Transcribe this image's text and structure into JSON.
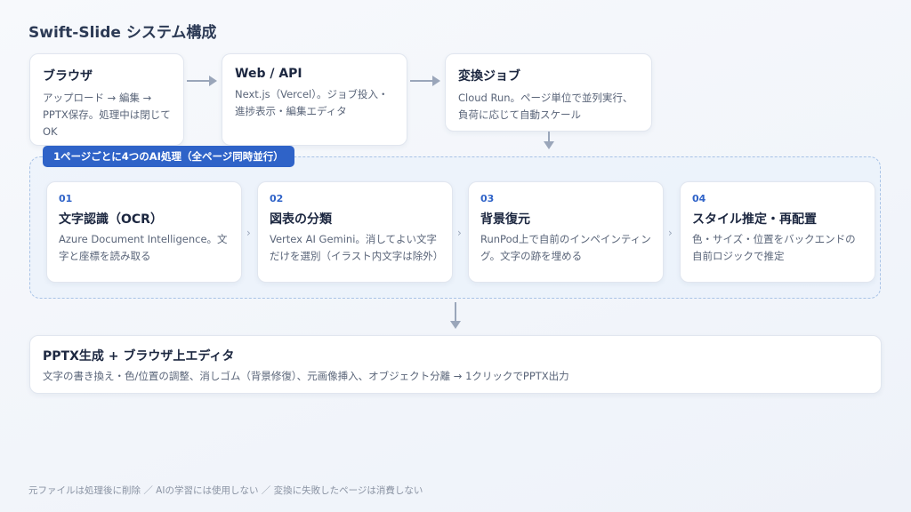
{
  "title": "Swift-Slide システム構成",
  "top_row": [
    {
      "heading": "ブラウザ",
      "desc": "アップロード → 編集 → PPTX保存。処理中は閉じてOK"
    },
    {
      "heading": "Web / API",
      "desc": "Next.js（Vercel）。ジョブ投入・進捗表示・編集エディタ"
    },
    {
      "heading": "変換ジョブ",
      "desc": "Cloud Run。ページ単位で並列実行、負荷に応じて自動スケール"
    }
  ],
  "parallel_label": "1ページごとに4つのAI処理（全ページ同時並行）",
  "steps": [
    {
      "num": "01",
      "heading": "文字認識（OCR）",
      "desc": "Azure Document Intelligence。文字と座標を読み取る"
    },
    {
      "num": "02",
      "heading": "図表の分類",
      "desc": "Vertex AI Gemini。消してよい文字だけを選別（イラスト内文字は除外）"
    },
    {
      "num": "03",
      "heading": "背景復元",
      "desc": "RunPod上で自前のインペインティング。文字の跡を埋める"
    },
    {
      "num": "04",
      "heading": "スタイル推定・再配置",
      "desc": "色・サイズ・位置をバックエンドの自前ロジックで推定"
    }
  ],
  "output": {
    "heading": "PPTX生成 + ブラウザ上エディタ",
    "desc": "文字の書き換え・色/位置の調整、消しゴム（背景修復）、元画像挿入、オブジェクト分離 → 1クリックでPPTX出力"
  },
  "footer": "元ファイルは処理後に削除 ／ AIの学習には使用しない ／ 変換に失敗したページは消費しない",
  "colors": {
    "accent": "#2f63c8",
    "arrow": "#9aa6ba",
    "dashed_border": "#a9c3e6"
  }
}
